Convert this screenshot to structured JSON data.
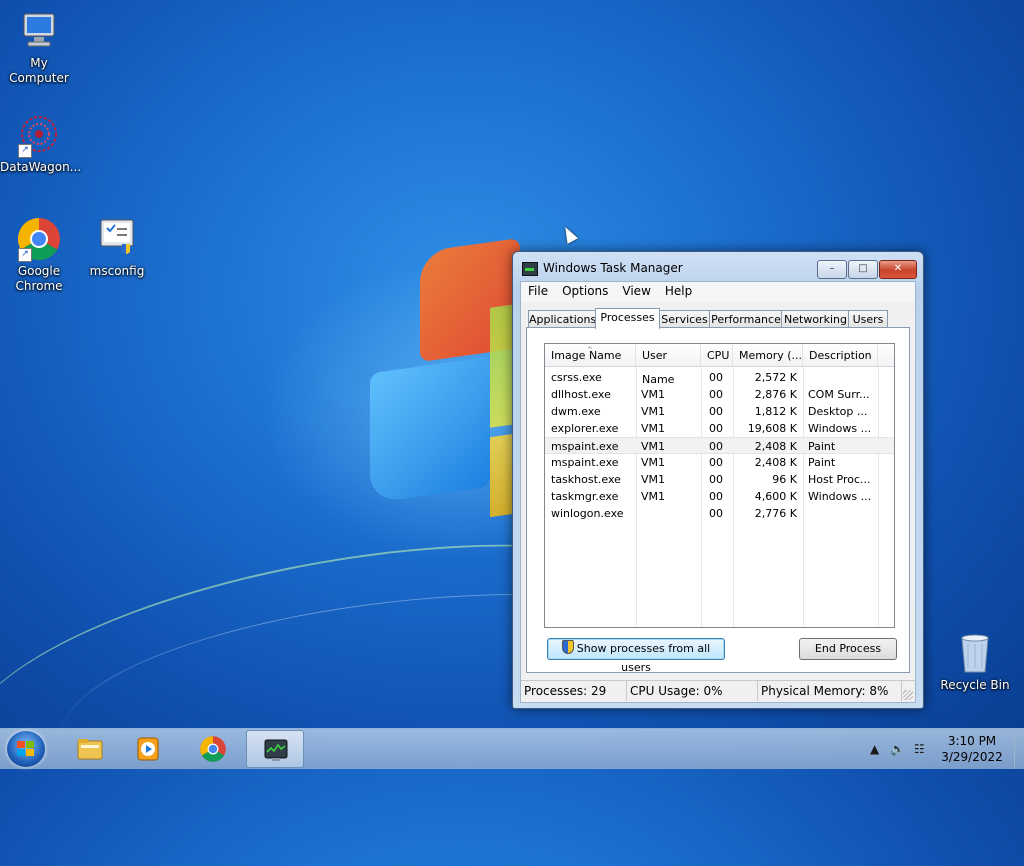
{
  "desktop": {
    "icons": [
      {
        "label": "My Computer",
        "icon": "computer-icon"
      },
      {
        "label": "DataWagon...",
        "icon": "datawagon-icon"
      },
      {
        "label": "Google Chrome",
        "icon": "chrome-icon"
      },
      {
        "label": "msconfig",
        "icon": "msconfig-icon"
      },
      {
        "label": "Recycle Bin",
        "icon": "recycle-bin-icon"
      }
    ]
  },
  "task_manager": {
    "title": "Windows Task Manager",
    "menu": [
      "File",
      "Options",
      "View",
      "Help"
    ],
    "tabs": [
      "Applications",
      "Processes",
      "Services",
      "Performance",
      "Networking",
      "Users"
    ],
    "active_tab": "Processes",
    "columns": [
      "Image Name",
      "User Name",
      "CPU",
      "Memory (...",
      "Description"
    ],
    "sort_indicator": "^",
    "processes": [
      {
        "name": "csrss.exe",
        "user": "",
        "cpu": "00",
        "memory": "2,572 K",
        "description": ""
      },
      {
        "name": "dllhost.exe",
        "user": "VM1",
        "cpu": "00",
        "memory": "2,876 K",
        "description": "COM Surr..."
      },
      {
        "name": "dwm.exe",
        "user": "VM1",
        "cpu": "00",
        "memory": "1,812 K",
        "description": "Desktop ..."
      },
      {
        "name": "explorer.exe",
        "user": "VM1",
        "cpu": "00",
        "memory": "19,608 K",
        "description": "Windows ..."
      },
      {
        "name": "mspaint.exe",
        "user": "VM1",
        "cpu": "00",
        "memory": "2,408 K",
        "description": "Paint"
      },
      {
        "name": "mspaint.exe",
        "user": "VM1",
        "cpu": "00",
        "memory": "2,408 K",
        "description": "Paint"
      },
      {
        "name": "taskhost.exe",
        "user": "VM1",
        "cpu": "00",
        "memory": "96 K",
        "description": "Host Proc..."
      },
      {
        "name": "taskmgr.exe",
        "user": "VM1",
        "cpu": "00",
        "memory": "4,600 K",
        "description": "Windows ..."
      },
      {
        "name": "winlogon.exe",
        "user": "",
        "cpu": "00",
        "memory": "2,776 K",
        "description": ""
      }
    ],
    "show_all_button": "Show processes from all users",
    "end_process_button": "End Process",
    "status": {
      "processes": "Processes: 29",
      "cpu": "CPU Usage: 0%",
      "memory": "Physical Memory: 8%"
    }
  },
  "taskbar": {
    "pinned": [
      "start-orb-icon",
      "explorer-folder-icon",
      "media-player-icon",
      "chrome-icon",
      "task-manager-icon"
    ],
    "active_app": "task-manager-icon",
    "clock_time": "3:10 PM",
    "clock_date": "3/29/2022"
  }
}
